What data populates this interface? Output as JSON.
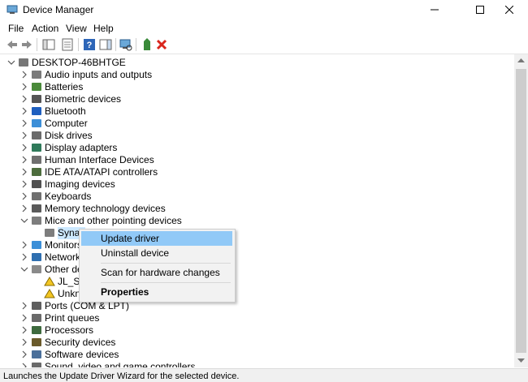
{
  "window": {
    "title": "Device Manager"
  },
  "menubar": [
    "File",
    "Action",
    "View",
    "Help"
  ],
  "tree": {
    "root": "DESKTOP-46BHTGE",
    "nodes": [
      {
        "label": "Audio inputs and outputs",
        "icon": "speaker-icon"
      },
      {
        "label": "Batteries",
        "icon": "battery-icon"
      },
      {
        "label": "Biometric devices",
        "icon": "fingerprint-icon"
      },
      {
        "label": "Bluetooth",
        "icon": "bluetooth-icon"
      },
      {
        "label": "Computer",
        "icon": "monitor-icon"
      },
      {
        "label": "Disk drives",
        "icon": "disk-icon"
      },
      {
        "label": "Display adapters",
        "icon": "display-adapter-icon"
      },
      {
        "label": "Human Interface Devices",
        "icon": "hid-icon"
      },
      {
        "label": "IDE ATA/ATAPI controllers",
        "icon": "controller-icon"
      },
      {
        "label": "Imaging devices",
        "icon": "camera-icon"
      },
      {
        "label": "Keyboards",
        "icon": "keyboard-icon"
      },
      {
        "label": "Memory technology devices",
        "icon": "memory-icon"
      },
      {
        "label": "Mice and other pointing devices",
        "icon": "mouse-icon",
        "expanded": true
      },
      {
        "label": "Synap",
        "icon": "mouse-icon",
        "child": true,
        "selected": true
      },
      {
        "label": "Monitors",
        "icon": "monitor-icon"
      },
      {
        "label": "Network",
        "icon": "network-icon"
      },
      {
        "label": "Other dev",
        "icon": "unknown-device-icon",
        "expanded": true
      },
      {
        "label": "JL_SP",
        "icon": "warning-device-icon",
        "child": true
      },
      {
        "label": "Unkn",
        "icon": "warning-device-icon",
        "child": true
      },
      {
        "label": "Ports (COM & LPT)",
        "icon": "port-icon"
      },
      {
        "label": "Print queues",
        "icon": "printer-icon"
      },
      {
        "label": "Processors",
        "icon": "processor-icon"
      },
      {
        "label": "Security devices",
        "icon": "security-icon"
      },
      {
        "label": "Software devices",
        "icon": "software-icon"
      },
      {
        "label": "Sound, video and game controllers",
        "icon": "sound-icon"
      }
    ]
  },
  "context_menu": {
    "update": "Update driver",
    "uninstall": "Uninstall device",
    "scan": "Scan for hardware changes",
    "properties": "Properties"
  },
  "status": "Launches the Update Driver Wizard for the selected device."
}
